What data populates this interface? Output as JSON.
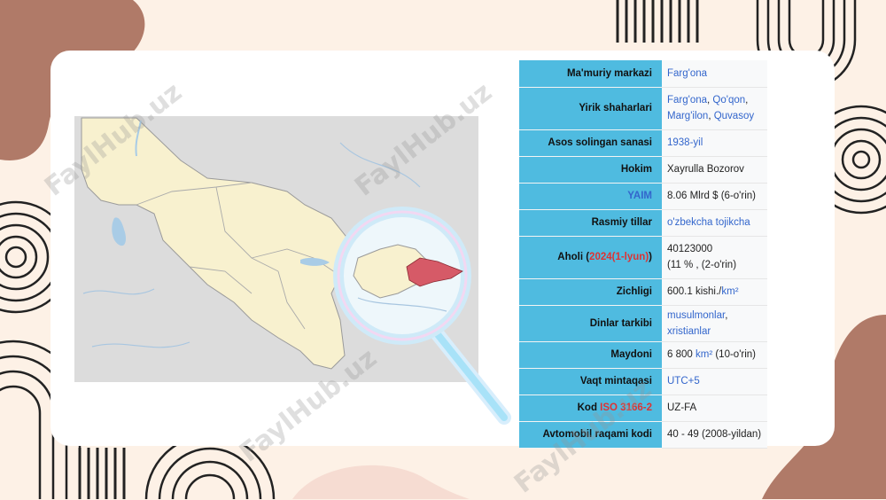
{
  "watermark": "FaylHub.uz",
  "colors": {
    "background": "#fdf1e6",
    "blob": "#b07a68",
    "header_cell": "#4fbbe0",
    "region_highlight": "#d65a67",
    "link": "#3366cc"
  },
  "map": {
    "icons": [
      "magnifier-icon"
    ],
    "highlight": "Farg'ona region"
  },
  "infobox": {
    "rows": {
      "center": {
        "label": "Ma'muriy markazi",
        "value": "Farg'ona"
      },
      "cities": {
        "label": "Yirik shaharlari",
        "c1": "Farg'ona",
        "sep1": ", ",
        "c2": "Qo'qon",
        "sep2": ",",
        "c3": "Marg'ilon",
        "sep3": ", ",
        "c4": "Quvasoy"
      },
      "founded": {
        "label": "Asos solingan sanasi",
        "value": "1938-yil"
      },
      "hokim": {
        "label": "Hokim",
        "value": "Xayrulla Bozorov"
      },
      "gdp": {
        "label": "YAIM",
        "value": "8.06 Mlrd $  (6-o'rin)"
      },
      "lang": {
        "label": "Rasmiy tillar",
        "value": "o'zbekcha tojikcha"
      },
      "pop": {
        "label_pre": "Aholi (",
        "label_link": "2024(1-lyun)",
        "label_post": ")",
        "line1": "40123000",
        "line2": "(11 % ,  (2-o'rin)"
      },
      "density": {
        "label": "Zichligi",
        "value_pre": "600.1 kishi./",
        "value_link": "km²"
      },
      "religion": {
        "label": "Dinlar tarkibi",
        "v1": "musulmonlar",
        "sep": ", ",
        "v2": "xristianlar"
      },
      "area": {
        "label": "Maydoni",
        "value_pre": "6 800 ",
        "value_link": "km²",
        "value_post": " (10-o'rin)"
      },
      "tz": {
        "label": "Vaqt mintaqasi",
        "value": "UTC+5"
      },
      "code": {
        "label_pre": "Kod ",
        "label_link": "ISO 3166-2",
        "value": "UZ-FA"
      },
      "auto": {
        "label": "Avtomobil raqami kodi",
        "value": "40 - 49 (2008-yildan)"
      }
    }
  }
}
